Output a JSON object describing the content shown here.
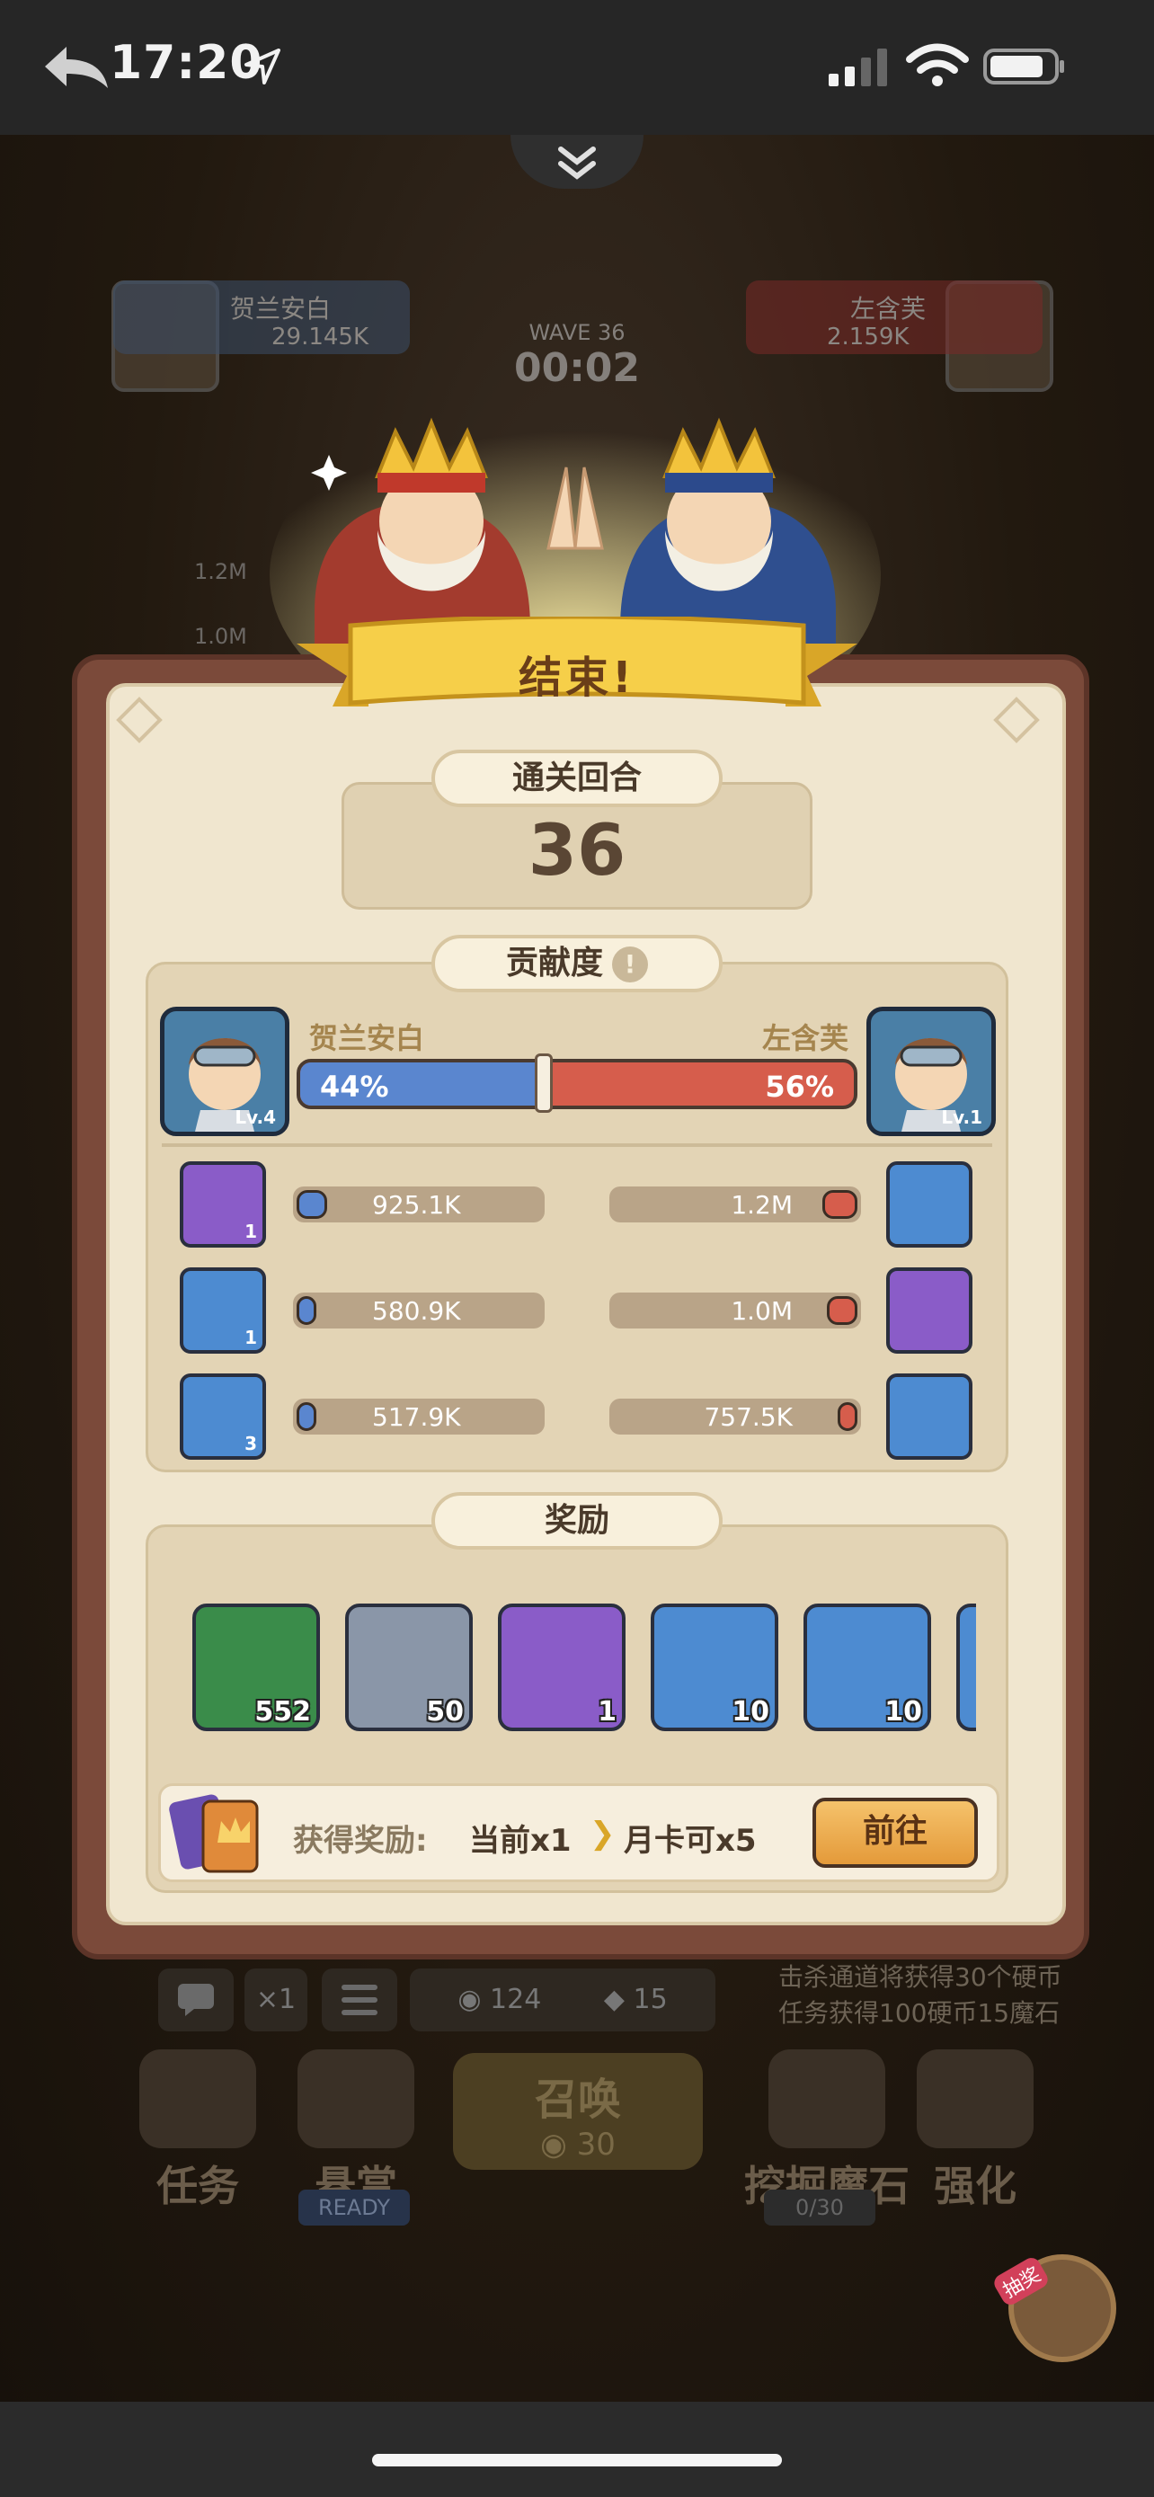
{
  "status_bar": {
    "time": "17:20"
  },
  "background": {
    "left_player": {
      "name": "贺兰安白",
      "score": "29.145K",
      "level": "Lv.4"
    },
    "right_player": {
      "name": "左含芙",
      "score": "2.159K",
      "level": "Lv.1"
    },
    "wave": {
      "label": "WAVE 36",
      "timer": "00:02"
    },
    "side_values": [
      "1.2M",
      "1.0M"
    ],
    "chat_multiplier": "×1",
    "coins": "124",
    "gems": "15",
    "notes": [
      "击杀通道将获得30个硬币",
      "任务获得100硬币15魔石"
    ],
    "buttons": {
      "task": "任务",
      "bounty": "悬赏",
      "summon": "召唤",
      "summon_cost": "30",
      "dig": "挖掘魔石",
      "upgrade": "强化"
    },
    "ready_tag": "READY",
    "dig_progress": "0/30",
    "mascot_tag": "抽奖"
  },
  "result": {
    "title": "结束!",
    "round": {
      "label": "通关回合",
      "value": "36"
    },
    "contribution": {
      "label": "贡献度",
      "help": "!",
      "left": {
        "name": "贺兰安白",
        "level": "Lv.4",
        "percent_label": "44%",
        "percent": 44
      },
      "right": {
        "name": "左含芙",
        "level": "Lv.1",
        "percent_label": "56%",
        "percent": 56
      },
      "left_units": [
        {
          "name": "knight",
          "count": "1",
          "value": "925.1K",
          "fill": 0.12,
          "color": "#8a5cc8"
        },
        {
          "name": "red-demon",
          "count": "1",
          "value": "580.9K",
          "fill": 0.05,
          "color": "#4d8bd1"
        },
        {
          "name": "wizard",
          "count": "3",
          "value": "517.9K",
          "fill": 0.04,
          "color": "#4d8bd1"
        }
      ],
      "right_units": [
        {
          "name": "pilot",
          "count": "",
          "value": "1.2M",
          "fill": 0.14,
          "color": "#4d8bd1"
        },
        {
          "name": "mech",
          "count": "",
          "value": "1.0M",
          "fill": 0.12,
          "color": "#8a5cc8"
        },
        {
          "name": "elf-archer",
          "count": "",
          "value": "757.5K",
          "fill": 0.08,
          "color": "#4d8bd1"
        }
      ]
    },
    "reward": {
      "label": "奖励",
      "items": [
        {
          "name": "coin",
          "qty": "552",
          "color": "#3a8c4a"
        },
        {
          "name": "exp-potion",
          "qty": "50",
          "color": "#8a96a8"
        },
        {
          "name": "magic-scroll",
          "qty": "1",
          "color": "#8a5cc8"
        },
        {
          "name": "lightning-book",
          "qty": "10",
          "color": "#4d8bd1"
        },
        {
          "name": "nature-book",
          "qty": "10",
          "color": "#4d8bd1"
        },
        {
          "name": "more-item",
          "qty": "",
          "color": "#4d8bd1"
        }
      ],
      "claim_label": "获得奖励:",
      "current": "当前x1",
      "monthly": "月卡可x5",
      "go_button": "前往"
    }
  }
}
